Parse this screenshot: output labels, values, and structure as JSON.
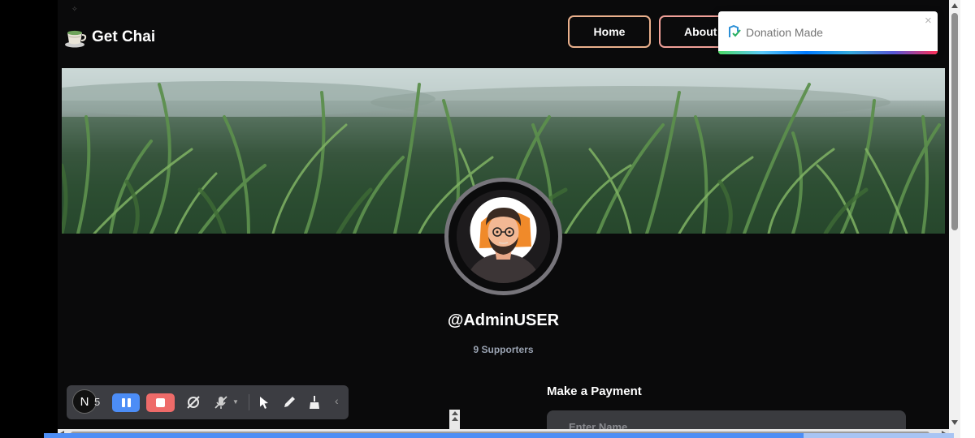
{
  "app": {
    "brand": "Get Chai"
  },
  "nav": {
    "home": "Home",
    "about": "About"
  },
  "toast": {
    "message": "Donation Made",
    "close": "×",
    "remaining_fraction": 1.0
  },
  "profile": {
    "username": "@AdminUSER",
    "supporters": "9 Supporters"
  },
  "payment": {
    "title": "Make a Payment",
    "name_placeholder": "Enter Name"
  },
  "recorder": {
    "badge_letter": "N",
    "counter": "5",
    "collapse": "‹",
    "icons": [
      "pause-icon",
      "stop-icon",
      "camera-off-icon",
      "mic-off-icon",
      "pointer-icon",
      "pen-icon",
      "broom-icon"
    ]
  },
  "page_progress": {
    "fraction": 0.835
  },
  "colors": {
    "background": "#0a0a0b",
    "nav_border": "#eab08c",
    "pause": "#4c8df6",
    "stop": "#ee6b69",
    "input": "#3a3b3f",
    "progress": "#4d8ef5"
  }
}
